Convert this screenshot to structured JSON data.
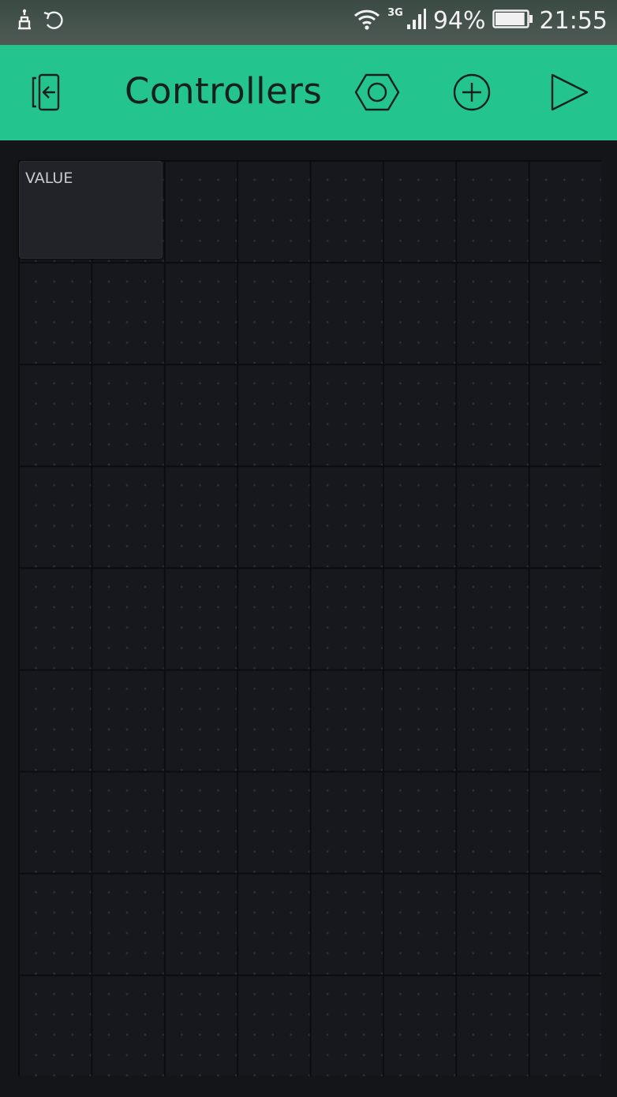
{
  "status_bar": {
    "left_icons": [
      "usb-debug-icon",
      "sync-icon"
    ],
    "network": "3G",
    "battery_percent": "94%",
    "battery_level": 0.94,
    "time": "21:55"
  },
  "app_bar": {
    "title": "Controllers",
    "background": "#23c48e",
    "icons": [
      "exit-icon",
      "settings-hex-icon",
      "add-circle-icon",
      "play-icon"
    ]
  },
  "canvas": {
    "background": "#17181d",
    "widget": {
      "label": "VALUE"
    }
  }
}
